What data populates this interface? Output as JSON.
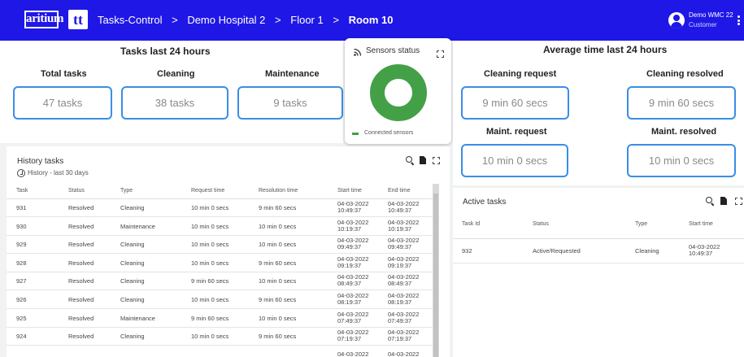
{
  "topbar": {
    "logo_text": "aritium",
    "logo_mark": "tt",
    "crumbs": [
      "Tasks-Control",
      "Demo Hospital 2",
      "Floor 1",
      "Room 10"
    ],
    "separator": ">",
    "user_name": "Demo WMC 22",
    "user_role": "Customer",
    "bg_color": "#1f17e6"
  },
  "tasks24": {
    "title": "Tasks last 24 hours",
    "stats": [
      {
        "label": "Total tasks",
        "value": "47 tasks"
      },
      {
        "label": "Cleaning",
        "value": "38 tasks"
      },
      {
        "label": "Maintenance",
        "value": "9 tasks"
      }
    ]
  },
  "sensors": {
    "title": "Sensors status",
    "legend": "Connected sensors",
    "color": "#43a047",
    "connected_fraction": 1.0
  },
  "avg": {
    "title": "Average time last 24 hours",
    "stats": [
      {
        "label": "Cleaning request",
        "value": "9 min 60 secs"
      },
      {
        "label": "Cleaning resolved",
        "value": "9 min 60 secs"
      },
      {
        "label": "Maint. request",
        "value": "10 min 0 secs"
      },
      {
        "label": "Maint. resolved",
        "value": "10 min 0 secs"
      }
    ]
  },
  "history": {
    "title": "History tasks",
    "subtitle": "History - last 30 days",
    "columns": [
      "Task",
      "Status",
      "Type",
      "Request time",
      "Resolution time",
      "Start time",
      "End time"
    ],
    "rows": [
      {
        "task": "931",
        "status": "Resolved",
        "type": "Cleaning",
        "request": "10 min 0 secs",
        "resolution": "9 min 60 secs",
        "start_date": "04-03-2022",
        "start_time": "10:49:37",
        "end_date": "04-03-2022",
        "end_time": "10:49:37"
      },
      {
        "task": "930",
        "status": "Resolved",
        "type": "Maintenance",
        "request": "10 min 0 secs",
        "resolution": "10 min 0 secs",
        "start_date": "04-03-2022",
        "start_time": "10:19:37",
        "end_date": "04-03-2022",
        "end_time": "10:19:37"
      },
      {
        "task": "929",
        "status": "Resolved",
        "type": "Cleaning",
        "request": "10 min 0 secs",
        "resolution": "10 min 0 secs",
        "start_date": "04-03-2022",
        "start_time": "09:49:37",
        "end_date": "04-03-2022",
        "end_time": "09:49:37"
      },
      {
        "task": "928",
        "status": "Resolved",
        "type": "Cleaning",
        "request": "10 min 0 secs",
        "resolution": "9 min 60 secs",
        "start_date": "04-03-2022",
        "start_time": "09:19:37",
        "end_date": "04-03-2022",
        "end_time": "09:19:37"
      },
      {
        "task": "927",
        "status": "Resolved",
        "type": "Cleaning",
        "request": "9 min 60 secs",
        "resolution": "10 min 0 secs",
        "start_date": "04-03-2022",
        "start_time": "08:49:37",
        "end_date": "04-03-2022",
        "end_time": "08:49:37"
      },
      {
        "task": "926",
        "status": "Resolved",
        "type": "Cleaning",
        "request": "10 min 0 secs",
        "resolution": "9 min 60 secs",
        "start_date": "04-03-2022",
        "start_time": "08:19:37",
        "end_date": "04-03-2022",
        "end_time": "08:19:37"
      },
      {
        "task": "925",
        "status": "Resolved",
        "type": "Maintenance",
        "request": "9 min 60 secs",
        "resolution": "10 min 0 secs",
        "start_date": "04-03-2022",
        "start_time": "07:49:37",
        "end_date": "04-03-2022",
        "end_time": "07:49:37"
      },
      {
        "task": "924",
        "status": "Resolved",
        "type": "Cleaning",
        "request": "10 min 0 secs",
        "resolution": "9 min 60 secs",
        "start_date": "04-03-2022",
        "start_time": "07:19:37",
        "end_date": "04-03-2022",
        "end_time": "07:19:37"
      }
    ],
    "partial_row": {
      "start_date": "04-03-2022",
      "end_date": "04-03-2022"
    }
  },
  "active": {
    "title": "Active tasks",
    "columns": [
      "Task Id",
      "Status",
      "Type",
      "Start time"
    ],
    "rows": [
      {
        "id": "932",
        "status": "Active/Requested",
        "type": "Cleaning",
        "start_date": "04-03-2022",
        "start_time": "10:49:37"
      }
    ]
  },
  "colors": {
    "accent": "#3a8ee6",
    "brand": "#1f17e6",
    "success": "#43a047"
  }
}
